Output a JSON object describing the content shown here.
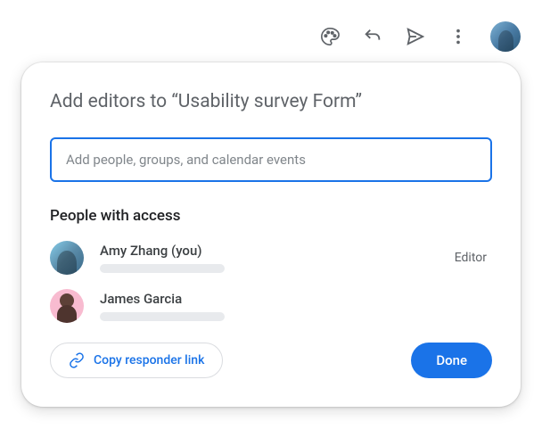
{
  "toolbar": {
    "palette_icon": "palette",
    "undo_icon": "undo",
    "send_icon": "send",
    "more_icon": "more-vert"
  },
  "dialog": {
    "title": "Add editors to “Usability survey Form”",
    "input_placeholder": "Add people, groups, and calendar events",
    "section_title": "People with access",
    "people": [
      {
        "name": "Amy Zhang (you)",
        "role": "Editor"
      },
      {
        "name": "James Garcia",
        "role": ""
      }
    ],
    "copy_link_label": "Copy responder link",
    "done_label": "Done"
  }
}
